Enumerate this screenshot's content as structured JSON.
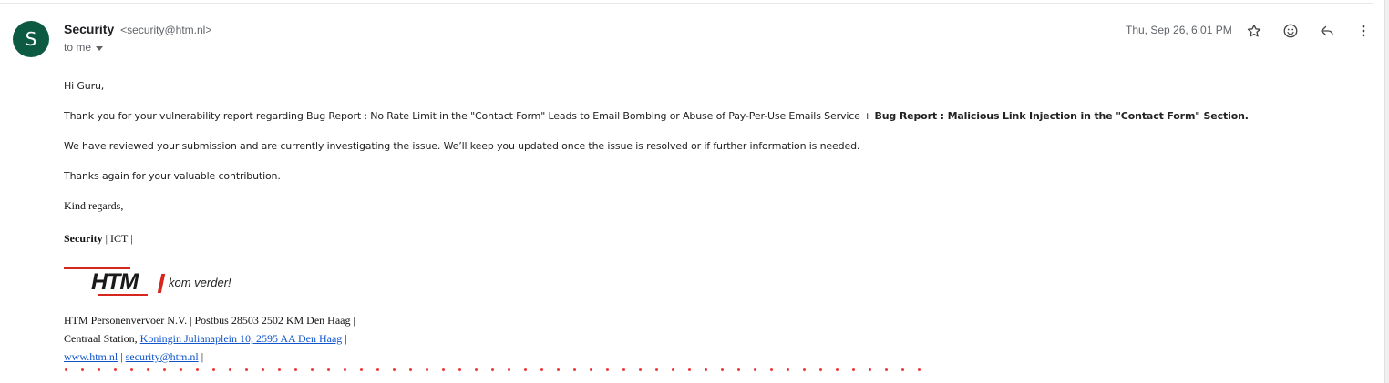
{
  "sender": {
    "avatar_letter": "S",
    "name": "Security",
    "email": "<security@htm.nl>",
    "to_label": "to me"
  },
  "meta": {
    "date": "Thu, Sep 26, 6:01 PM",
    "icons": [
      "star-icon",
      "emoji-icon",
      "reply-icon",
      "more-vert-icon"
    ]
  },
  "message": {
    "greeting": "Hi Guru,",
    "para1_normal": "Thank you for your vulnerability report regarding Bug Report : No Rate Limit in the \"Contact Form\" Leads to Email Bombing or Abuse of Pay-Per-Use Emails Service + ",
    "para1_bold": "Bug Report : Malicious Link Injection in the \"Contact Form\" Section.",
    "para2": "We have reviewed your submission and are currently investigating the issue. We’ll keep you updated once the issue is resolved or if further information is needed.",
    "para3": "Thanks again for your valuable contribution.",
    "closing": "Kind regards,"
  },
  "signature": {
    "name": "Security",
    "dept": " | ICT |",
    "logo_text": "HTM",
    "logo_tagline": "kom verder!",
    "line1": "HTM Personenvervoer N.V. | Postbus 28503 2502 KM Den Haag |",
    "line2_prefix": "Centraal Station, ",
    "address_link": "Koningin Julianaplein 10, 2595 AA Den Haag",
    "line2_suffix": " |",
    "website_link": "www.htm.nl",
    "sep": " | ",
    "email_link": "security@htm.nl",
    "line3_suffix": " |"
  },
  "colors": {
    "avatar_bg": "#0b5a41",
    "link": "#1155cc",
    "brand_red": "#d7261e",
    "dots": "#ef3b3b"
  }
}
